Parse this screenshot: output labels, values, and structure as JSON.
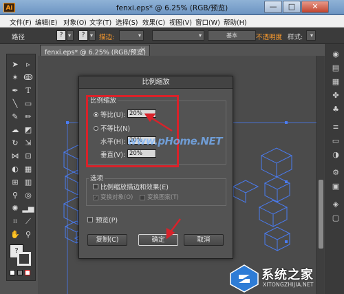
{
  "app": {
    "logo": "Ai",
    "window_title": "fenxi.eps* @ 6.25% (RGB/预览)",
    "window_buttons": [
      "—",
      "□",
      "✕"
    ]
  },
  "menu": {
    "items": [
      "文件(F)",
      "编辑(E)",
      "对象(O)",
      "文字(T)",
      "选择(S)",
      "效果(C)",
      "视图(V)",
      "窗口(W)",
      "帮助(H)"
    ]
  },
  "control_bar": {
    "path_label": "路径",
    "stroke_label": "描边:",
    "stroke_style": "基本",
    "opacity_label": "不透明度",
    "style_label": "样式:",
    "question": "?"
  },
  "document": {
    "tab_label": "fenxi.eps* @ 6.25% (RGB/预览)",
    "close_glyph": "×"
  },
  "tools": {
    "icons": [
      "selection-icon",
      "direct-selection-icon",
      "magic-wand-icon",
      "lasso-icon",
      "pen-icon",
      "type-icon",
      "line-icon",
      "rectangle-icon",
      "paintbrush-icon",
      "pencil-icon",
      "blob-brush-icon",
      "eraser-icon",
      "rotate-icon",
      "scale-icon",
      "width-icon",
      "free-transform-icon",
      "shape-builder-icon",
      "perspective-icon",
      "mesh-icon",
      "gradient-icon",
      "eyedropper-icon",
      "blend-icon",
      "symbol-sprayer-icon",
      "graph-icon",
      "artboard-icon",
      "slice-icon",
      "hand-icon",
      "zoom-icon"
    ],
    "question": "?"
  },
  "dialog": {
    "title": "比例缩放",
    "scale_group": {
      "title": "比例缩放",
      "uniform_label": "等比(U):",
      "uniform_value": "20%",
      "non_uniform_label": "不等比(N)",
      "horizontal_label": "水平(H):",
      "horizontal_value": "20%",
      "vertical_label": "垂直(V):",
      "vertical_value": "20%"
    },
    "options_group": {
      "title": "选项",
      "scale_strokes_label": "比例缩放描边和效果(E)",
      "transform_objects_label": "变换对象(O)",
      "transform_patterns_label": "变换图案(T)"
    },
    "preview_label": "预览(P)",
    "buttons": {
      "copy": "复制(C)",
      "ok": "确定",
      "cancel": "取消"
    }
  },
  "overlay": {
    "watermark_text": "www.pHome.NET",
    "highlight_color": "#d9222a",
    "arrow_color": "#d9222a"
  },
  "site_logo": {
    "title": "系统之家",
    "url": "XITONGZHIJIA.NET"
  },
  "colors": {
    "canvas": "#4b4b4b",
    "art_stroke": "#4a7cf2",
    "accent_orange": "#ff9d2e"
  }
}
